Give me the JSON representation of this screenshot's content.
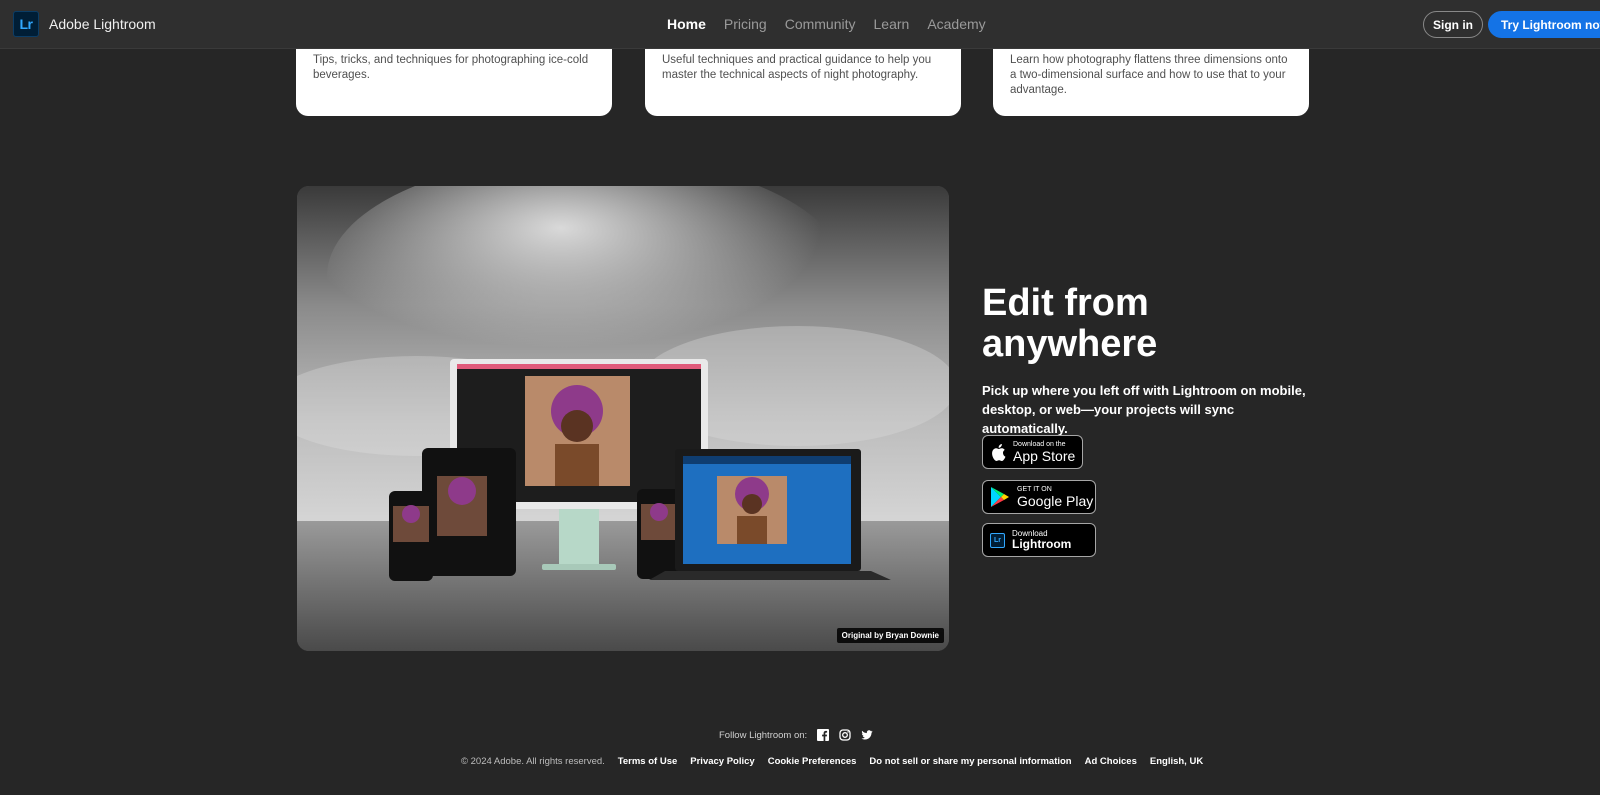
{
  "header": {
    "brand": "Adobe Lightroom",
    "logo_text": "Lr",
    "nav": [
      "Home",
      "Pricing",
      "Community",
      "Learn",
      "Academy"
    ],
    "sign_in": "Sign in",
    "cta": "Try Lightroom now"
  },
  "cards": [
    {
      "desc": "Tips, tricks, and techniques for photographing ice-cold beverages."
    },
    {
      "desc": "Useful techniques and practical guidance to help you master the technical aspects of night photography."
    },
    {
      "desc": "Learn how photography flattens three dimensions onto a two-dimensional surface and how to use that to your advantage."
    }
  ],
  "hero": {
    "credit": "Original by Bryan Downie"
  },
  "feature": {
    "headline": "Edit from anywhere",
    "body": "Pick up where you left off with Lightroom on mobile, desktop, or web—your projects will sync automatically.",
    "badges": {
      "appstore_small": "Download on the",
      "appstore_big": "App Store",
      "gplay_small": "GET IT ON",
      "gplay_big": "Google Play",
      "lr_small": "Download",
      "lr_big": "Lightroom",
      "lr_icon": "Lr"
    }
  },
  "footer": {
    "follow": "Follow Lightroom on:",
    "social_icons": [
      "facebook-icon",
      "instagram-icon",
      "twitter-icon"
    ],
    "copyright": "© 2024 Adobe. All rights reserved.",
    "links": [
      "Terms of Use",
      "Privacy Policy",
      "Cookie Preferences",
      "Do not sell or share my personal information",
      "Ad Choices",
      "English, UK"
    ]
  },
  "colors": {
    "background": "#262626",
    "header": "#2f2f2f",
    "accent": "#1473e6",
    "lightroom_blue": "#31a8ff"
  }
}
